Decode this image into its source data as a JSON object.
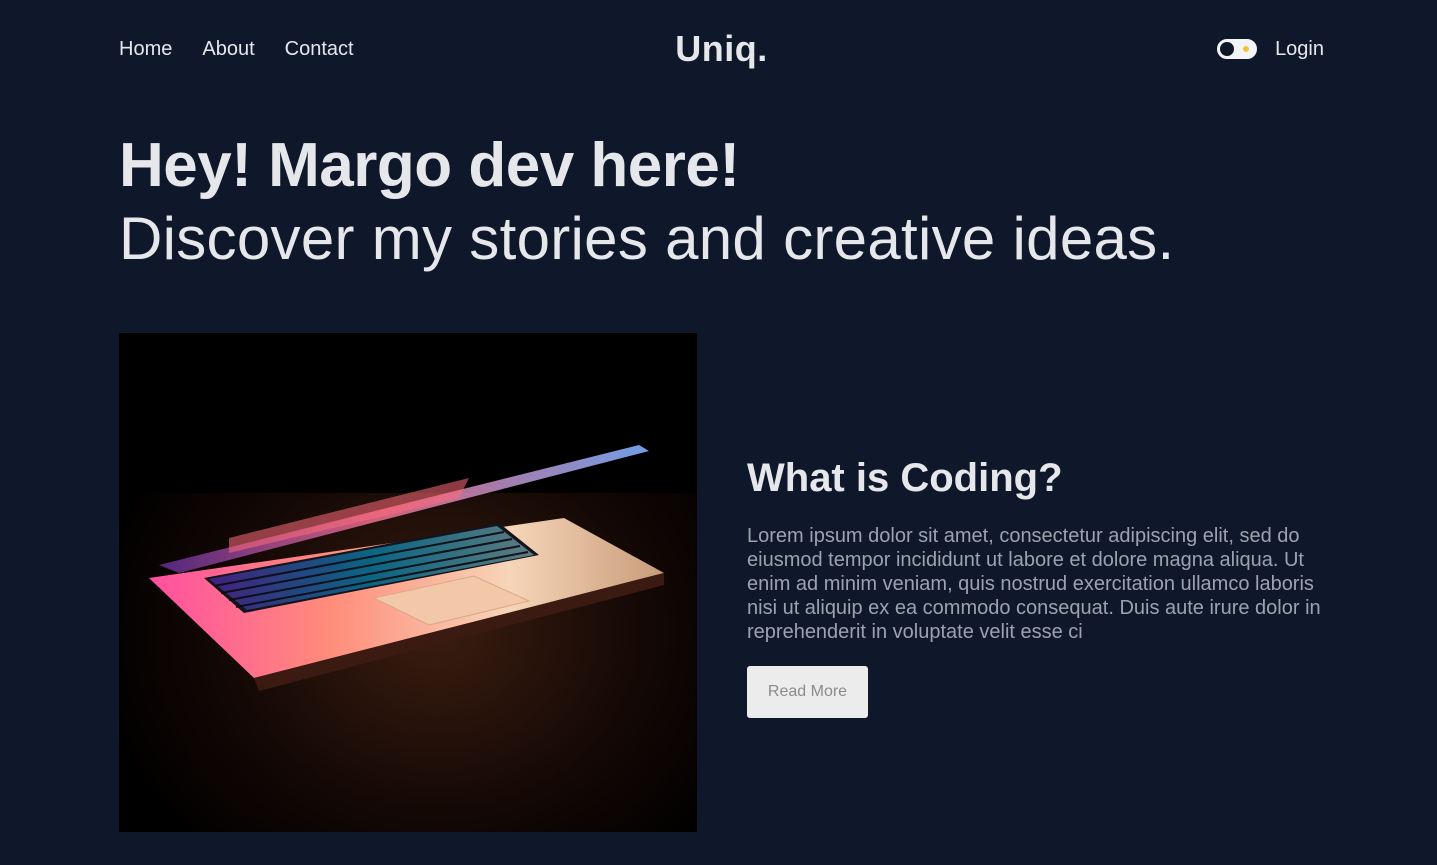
{
  "nav": {
    "links": [
      "Home",
      "About",
      "Contact"
    ],
    "logo": "Uniq.",
    "login": "Login",
    "theme_toggle_icon": "theme-toggle-icon"
  },
  "hero": {
    "title": "Hey! Margo dev here!",
    "subtitle": "Discover my stories and creative ideas."
  },
  "featured": {
    "title": "What is Coding?",
    "excerpt": "Lorem ipsum dolor sit amet, consectetur adipiscing elit, sed do eiusmod tempor incididunt ut labore et dolore magna aliqua. Ut enim ad minim veniam, quis nostrud exercitation ullamco laboris nisi ut aliquip ex ea commodo consequat. Duis aute irure dolor in reprehenderit in voluptate velit esse ci",
    "button": "Read More",
    "image": "laptop-photo"
  },
  "colors": {
    "background": "#0f172a",
    "text": "#e5e7eb",
    "muted": "#9ca3af",
    "toggle_accent": "#f4c430"
  }
}
